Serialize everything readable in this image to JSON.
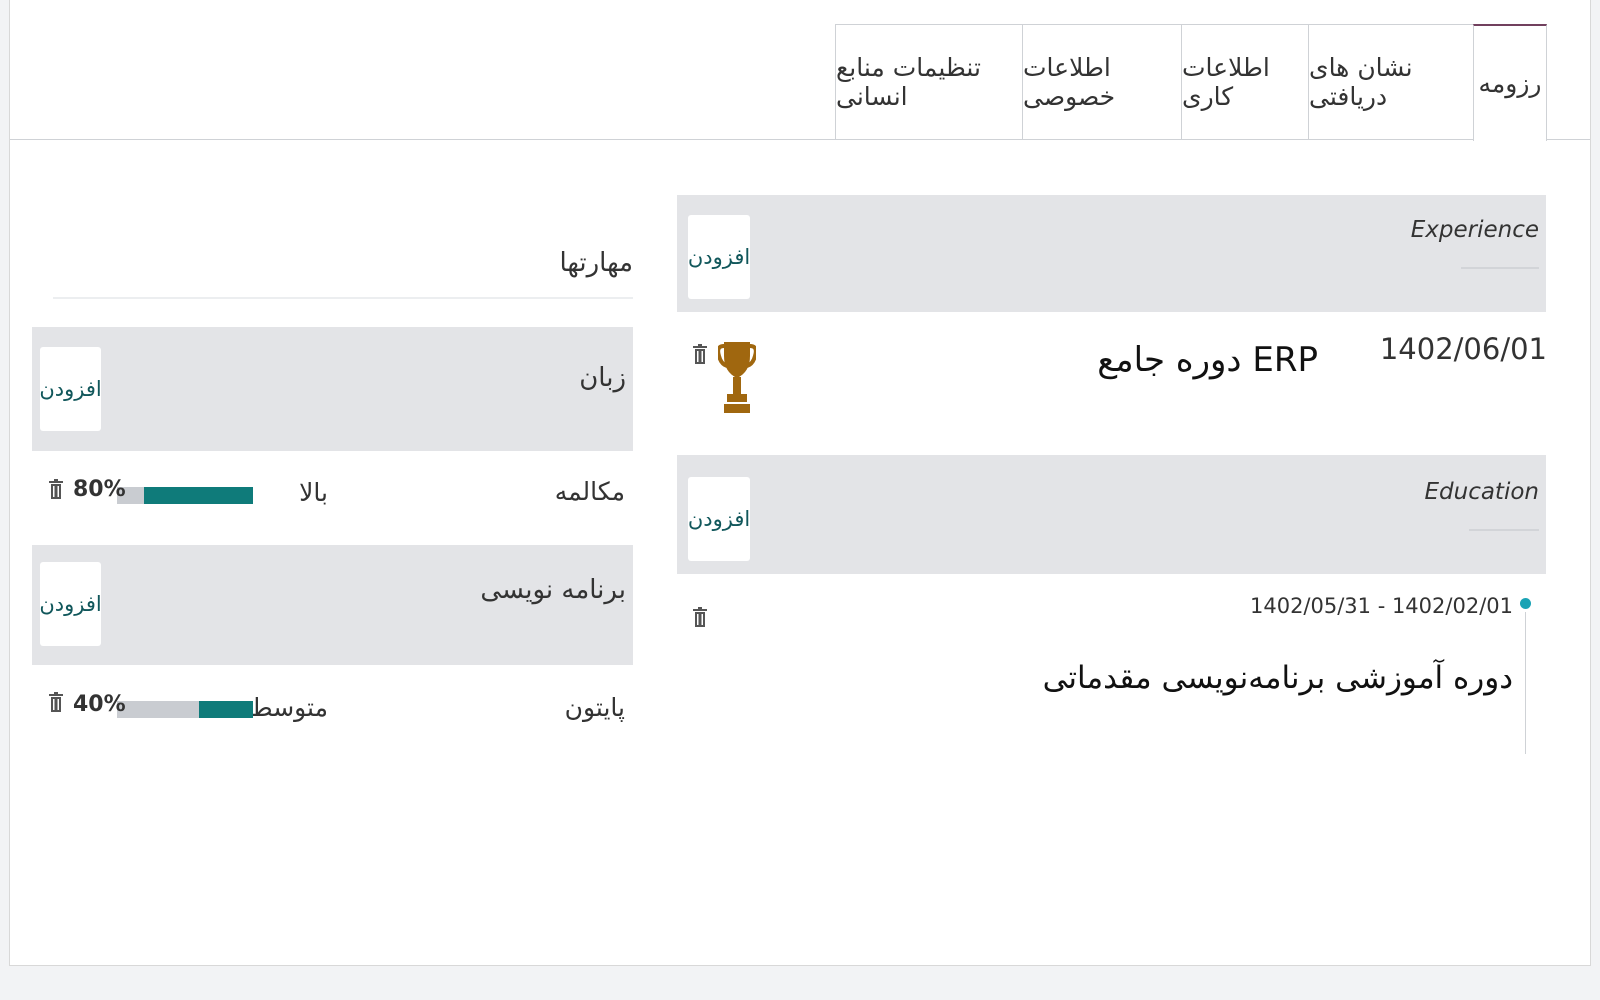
{
  "tabs": [
    {
      "label": "رزومه",
      "active": true
    },
    {
      "label": "نشان های دریافتی"
    },
    {
      "label": "اطلاعات کاری"
    },
    {
      "label": "اطلاعات خصوصی"
    },
    {
      "label": "تنظیمات منابع انسانی"
    }
  ],
  "resume": {
    "experience": {
      "title": "Experience",
      "add_label": "افزودن",
      "item": {
        "date": "1402/06/01",
        "name": "دوره جامع ERP",
        "icon": "trophy-icon"
      }
    },
    "education": {
      "title": "Education",
      "add_label": "افزودن",
      "item": {
        "date_range": "1402/05/31 - 1402/02/01",
        "name": "دوره آموزشی برنامه‌نویسی مقدماتی"
      }
    }
  },
  "skills": {
    "title": "مهارتها",
    "groups": [
      {
        "name": "زبان",
        "add_label": "افزودن",
        "items": [
          {
            "skill": "مکالمه",
            "level": "بالا",
            "progress": 80,
            "progress_label": "80%"
          }
        ]
      },
      {
        "name": "برنامه نویسی",
        "add_label": "افزودن",
        "items": [
          {
            "skill": "پایتون",
            "level": "متوسط",
            "progress": 40,
            "progress_label": "40%"
          }
        ]
      }
    ]
  },
  "colors": {
    "accent": "#0f7b7a",
    "button_text": "#11575b",
    "trophy": "#a0670f",
    "timeline": "#1aa3b5",
    "tab_active": "#71405e"
  }
}
